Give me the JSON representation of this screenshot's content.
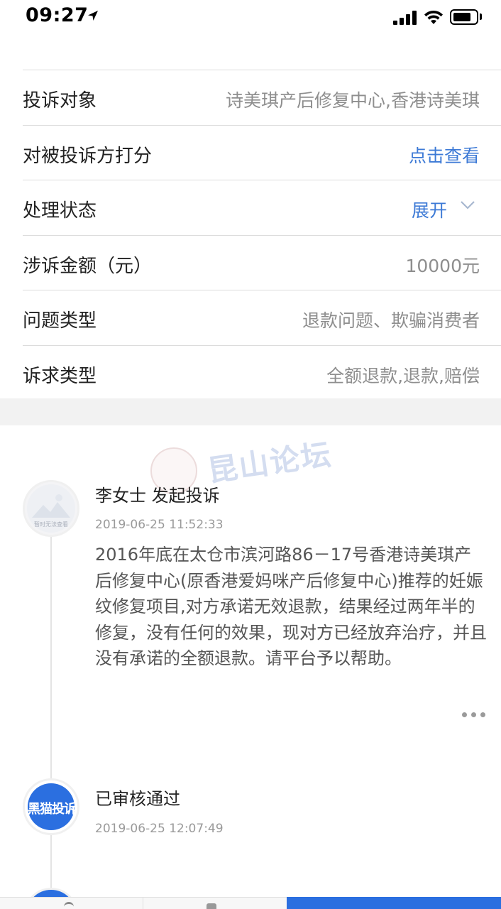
{
  "status_bar": {
    "time": "09:27"
  },
  "info_rows": [
    {
      "label": "投诉对象",
      "value": "诗美琪产后修复中心,香港诗美琪"
    },
    {
      "label": "对被投诉方打分",
      "value": "点击查看"
    },
    {
      "label": "处理状态",
      "value": "展开"
    },
    {
      "label": "涉诉金额（元）",
      "value": "10000元"
    },
    {
      "label": "问题类型",
      "value": "退款问题、欺骗消费者"
    },
    {
      "label": "诉求类型",
      "value": "全额退款,退款,赔偿"
    }
  ],
  "watermark": {
    "text": "昆山论坛"
  },
  "timeline": [
    {
      "avatar_text": "暂时无法查看",
      "title": "李女士 发起投诉",
      "time": "2019-06-25 11:52:33",
      "body": "2016年底在太仓市滨河路86－17号香港诗美琪产后修复中心(原香港爱妈咪产后修复中心)推荐的妊娠纹修复项目,对方承诺无效退款，结果经过两年半的修复，没有任何的效果，现对方已经放弃治疗，并且没有承诺的全额退款。请平台予以帮助。"
    },
    {
      "avatar_text": "黑猫投诉",
      "title": "已审核通过",
      "time": "2019-06-25 12:07:49"
    }
  ],
  "colors": {
    "link": "#3d7ad6",
    "brand": "#2b6fe0",
    "separator": "#f2f2f2"
  }
}
